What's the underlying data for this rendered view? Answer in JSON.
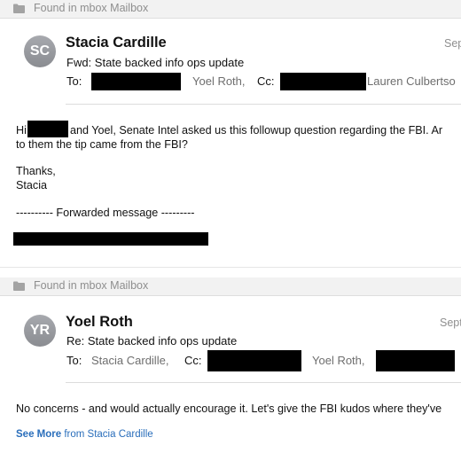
{
  "messages": [
    {
      "folder_banner": "Found in mbox Mailbox",
      "avatar_initials": "SC",
      "sender": "Stacia Cardille",
      "subject": "Fwd: State backed info ops update",
      "date": "Sep",
      "to_label": "To:",
      "to_visible": "Yoel Roth,",
      "cc_label": "Cc:",
      "cc_visible": "Lauren Culbertso",
      "body": {
        "greeting_prefix": "Hi",
        "greeting_rest": "and Yoel, Senate Intel asked us this followup question regarding the FBI. Ar",
        "line2": "to them the tip came from the FBI?",
        "thanks": "Thanks,",
        "signature": "Stacia",
        "forwarded": "---------- Forwarded message ---------"
      }
    },
    {
      "folder_banner": "Found in mbox Mailbox",
      "avatar_initials": "YR",
      "sender": "Yoel Roth",
      "subject": "Re: State backed info ops update",
      "date": "Sept",
      "to_label": "To:",
      "to_visible": "Stacia Cardille,",
      "cc_label": "Cc:",
      "cc_visible": "Yoel Roth,",
      "body": {
        "line1": "No concerns - and would actually encourage it. Let's give the FBI kudos where they've"
      }
    }
  ],
  "see_more": {
    "bold": "See More",
    "rest": "from Stacia Cardille"
  }
}
